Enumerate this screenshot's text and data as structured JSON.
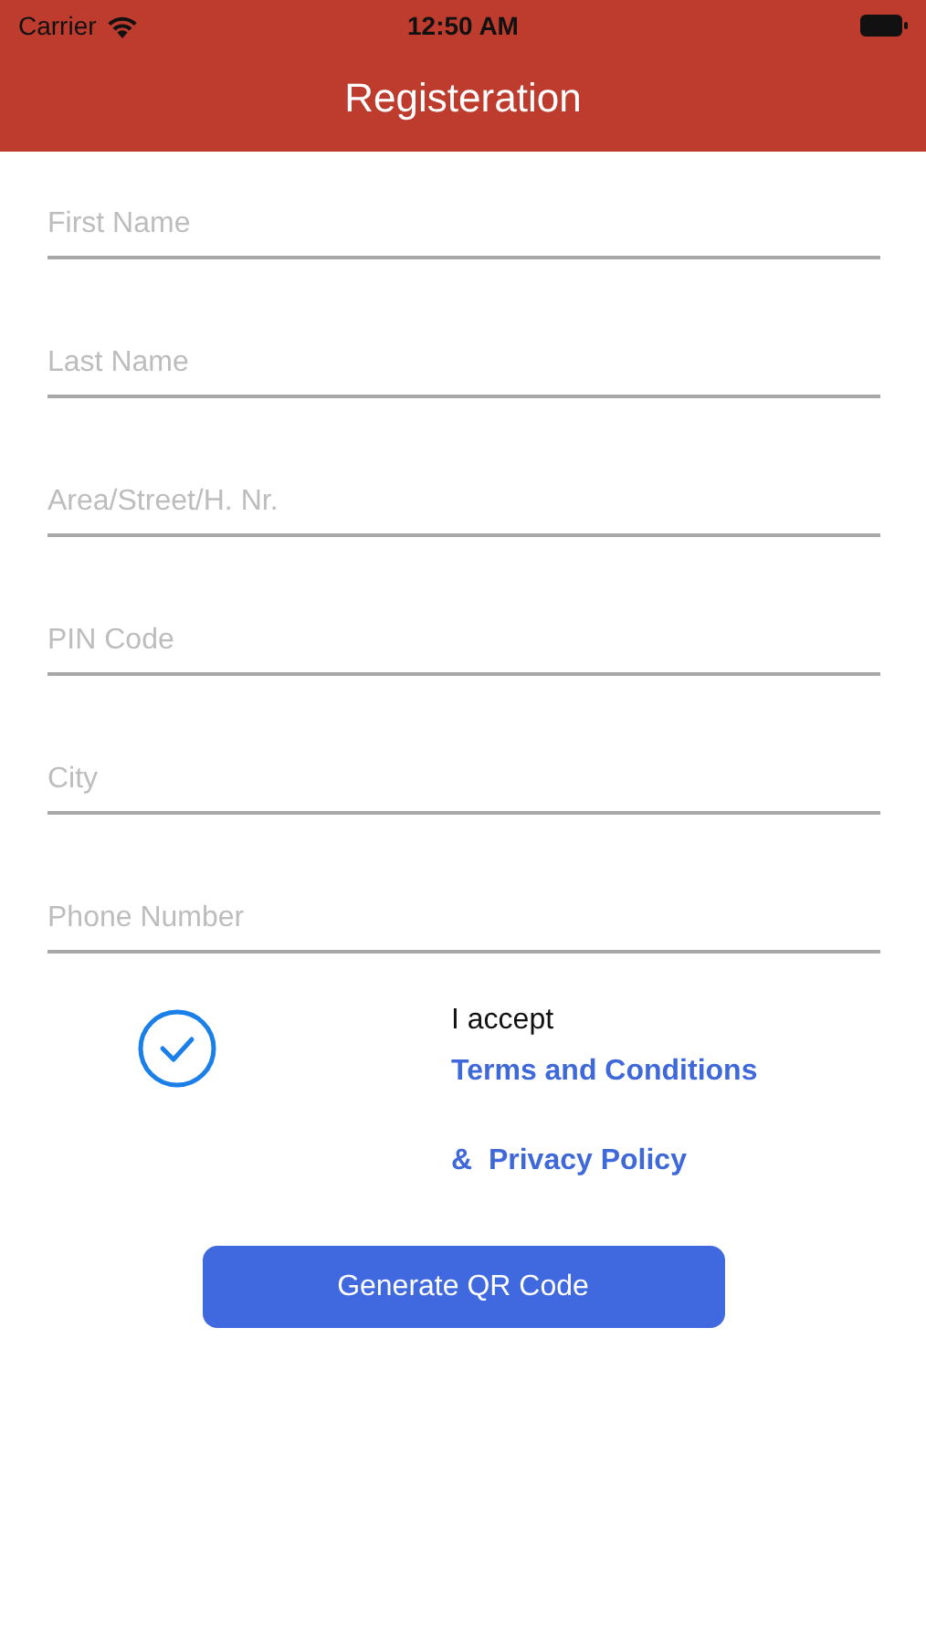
{
  "status_bar": {
    "carrier": "Carrier",
    "time": "12:50 AM"
  },
  "nav_bar": {
    "title": "Registeration"
  },
  "fields": [
    {
      "placeholder": "First Name"
    },
    {
      "placeholder": "Last Name"
    },
    {
      "placeholder": "Area/Street/H. Nr."
    },
    {
      "placeholder": "PIN Code"
    },
    {
      "placeholder": "City"
    },
    {
      "placeholder": "Phone Number"
    }
  ],
  "agreement": {
    "checked": true,
    "intro": "I accept",
    "terms_link": "Terms and Conditions",
    "privacy_link": "&  Privacy Policy"
  },
  "submit_button": "Generate QR Code"
}
